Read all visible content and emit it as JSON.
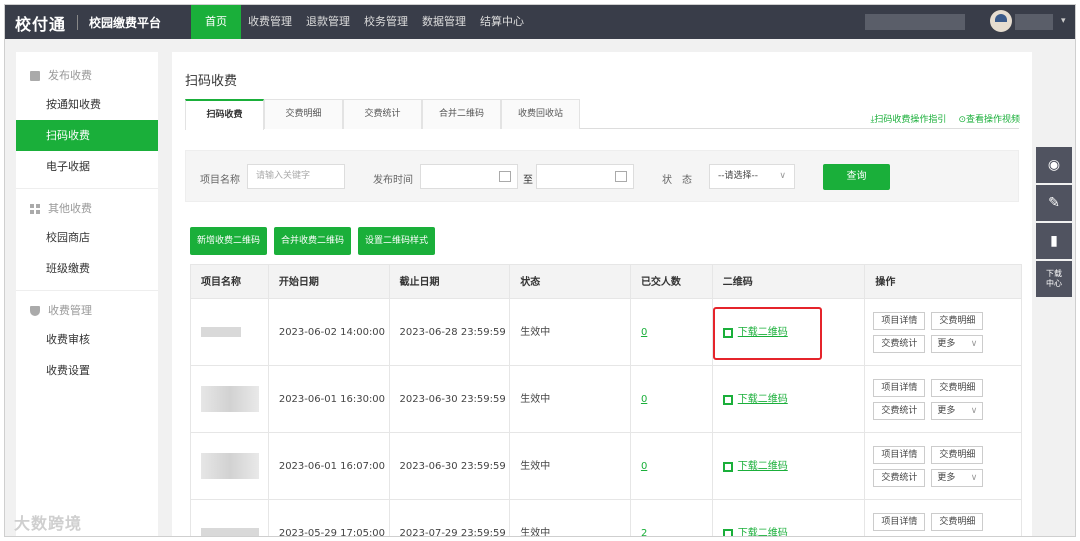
{
  "topbar": {
    "logo": "校付通",
    "platform": "校园缴费平台",
    "nav": [
      "首页",
      "收费管理",
      "退款管理",
      "校务管理",
      "数据管理",
      "结算中心"
    ]
  },
  "sidebar": {
    "groups": [
      {
        "title": "发布收费",
        "items": [
          "按通知收费",
          "扫码收费",
          "电子收据"
        ]
      },
      {
        "title": "其他收费",
        "items": [
          "校园商店",
          "班级缴费"
        ]
      },
      {
        "title": "收费管理",
        "items": [
          "收费审核",
          "收费设置"
        ]
      }
    ]
  },
  "main": {
    "title": "扫码收费",
    "tabs": [
      "扫码收费",
      "交费明细",
      "交费统计",
      "合并二维码",
      "收费回收站"
    ],
    "guide_link": "扫码收费操作指引",
    "video_link": "查看操作视频",
    "filter": {
      "name_label": "项目名称",
      "name_placeholder": "请输入关键字",
      "time_label": "发布时间",
      "to_label": "至",
      "status_label": "状　态",
      "status_value": "--请选择--",
      "query_label": "查询"
    },
    "actions": [
      "新增收费二维码",
      "合并收费二维码",
      "设置二维码样式"
    ],
    "table": {
      "headers": [
        "项目名称",
        "开始日期",
        "截止日期",
        "状态",
        "已交人数",
        "二维码",
        "操作"
      ],
      "rows": [
        {
          "start": "2023-06-02 14:00:00",
          "end": "2023-06-28 23:59:59",
          "status": "生效中",
          "count": "0",
          "qr": "下载二维码"
        },
        {
          "start": "2023-06-01 16:30:00",
          "end": "2023-06-30 23:59:59",
          "status": "生效中",
          "count": "0",
          "qr": "下载二维码"
        },
        {
          "start": "2023-06-01 16:07:00",
          "end": "2023-06-30 23:59:59",
          "status": "生效中",
          "count": "0",
          "qr": "下载二维码"
        },
        {
          "start": "2023-05-29 17:05:00",
          "end": "2023-07-29 23:59:59",
          "status": "生效中",
          "count": "2",
          "qr": "下载二维码"
        }
      ],
      "ops": {
        "detail": "项目详情",
        "records": "交费明细",
        "stats": "交费统计",
        "more": "更多"
      }
    }
  },
  "floatbar": {
    "download_center": "下载中心"
  },
  "watermark": "大数跨境"
}
